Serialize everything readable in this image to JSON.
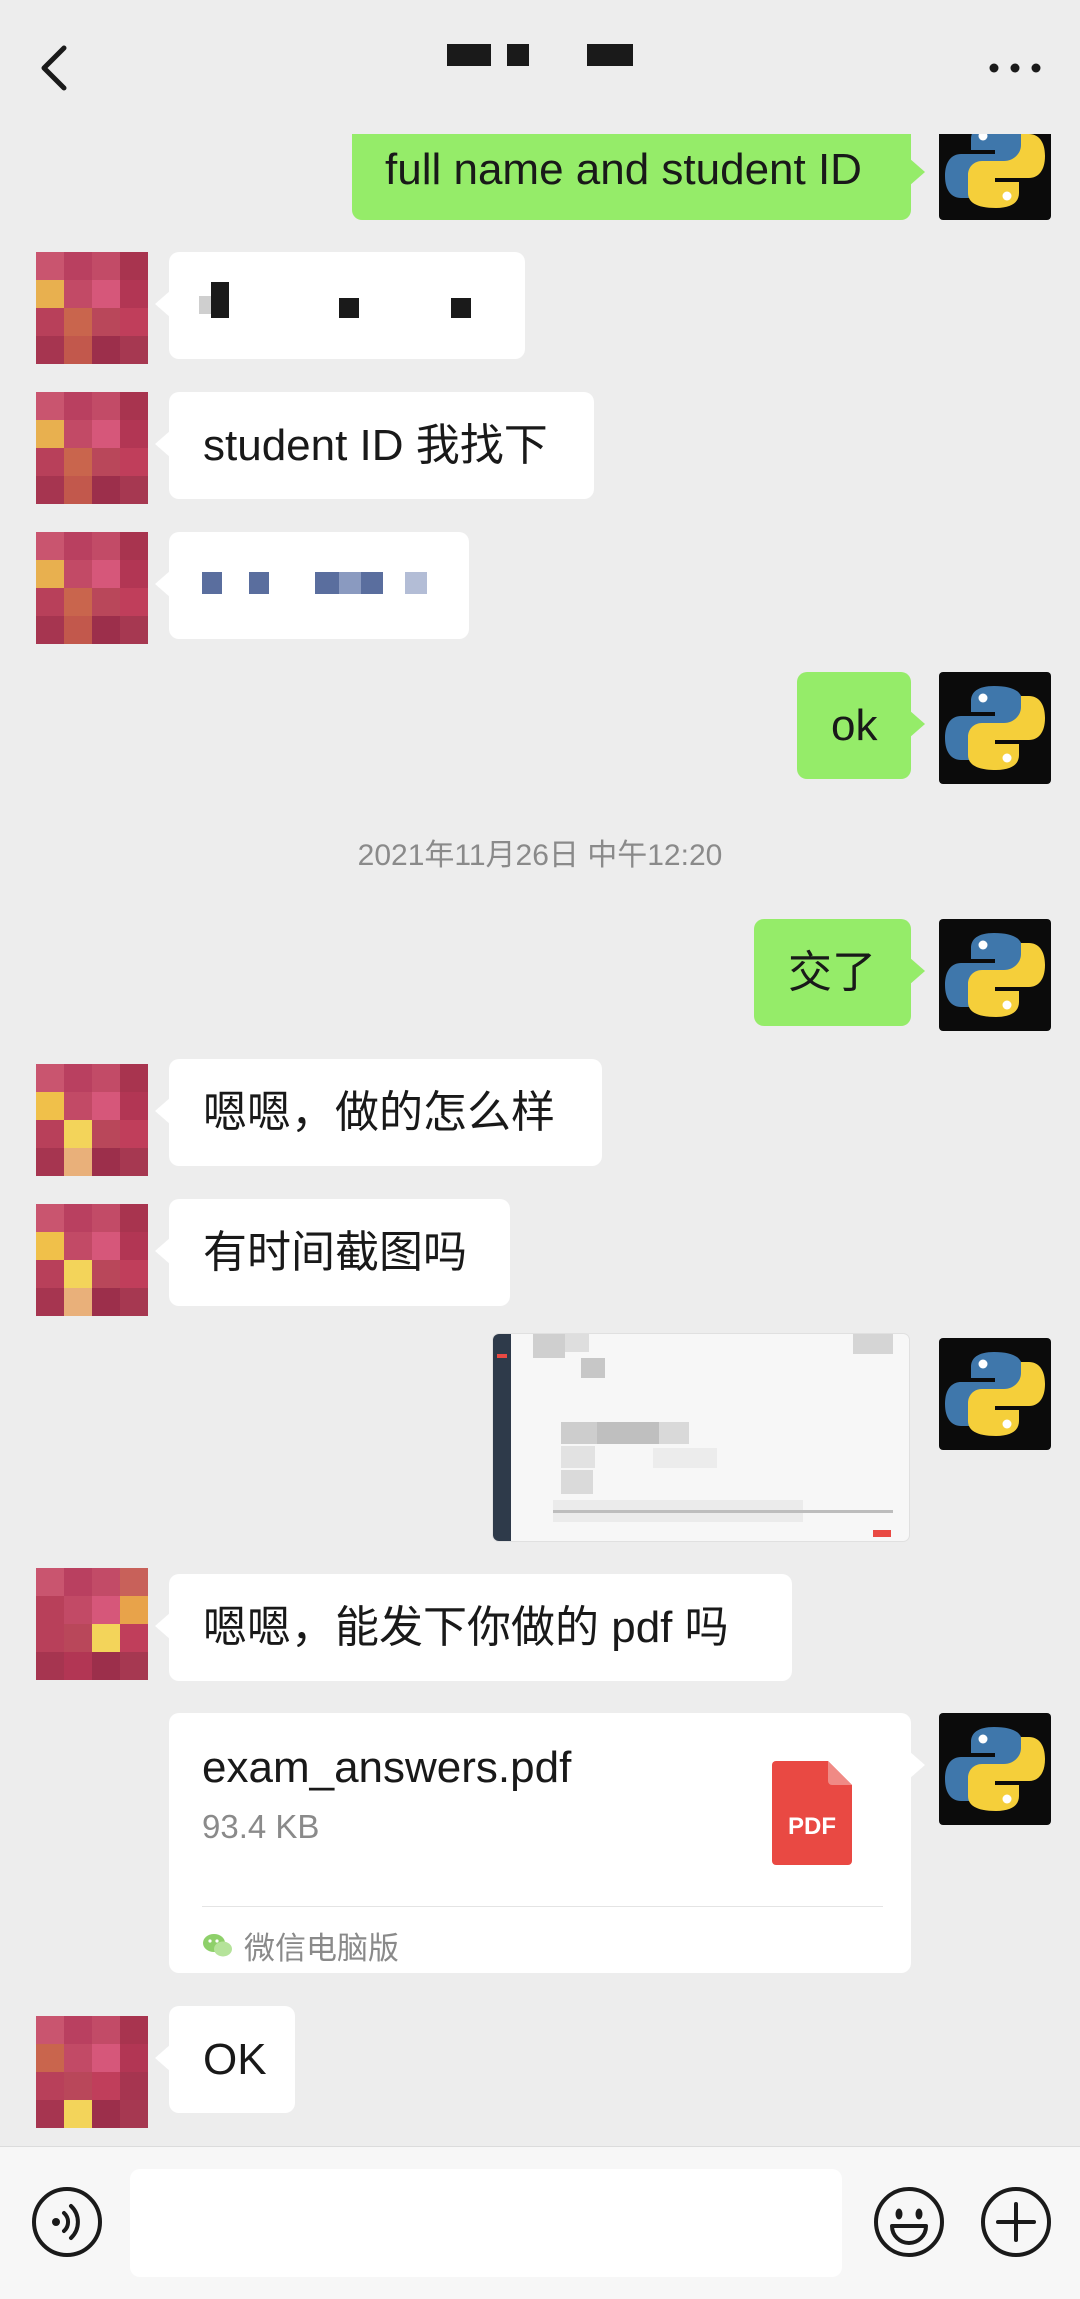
{
  "header": {
    "title": "",
    "back_icon": "chevron-left-icon",
    "more_icon": "more-dots-icon"
  },
  "messages": [
    {
      "side": "right",
      "text": "full name and student ID"
    },
    {
      "side": "left",
      "text": ""
    },
    {
      "side": "left",
      "text": "student ID 我找下"
    },
    {
      "side": "left",
      "text": ""
    },
    {
      "side": "right",
      "text": "ok"
    },
    {
      "side": "right",
      "text": "交了"
    },
    {
      "side": "left",
      "text": "嗯嗯，做的怎么样"
    },
    {
      "side": "left",
      "text": "有时间截图吗"
    },
    {
      "side": "left",
      "text": "嗯嗯，能发下你做的 pdf 吗"
    },
    {
      "side": "left",
      "text": "OK"
    }
  ],
  "timestamp": "2021年11月26日 中午12:20",
  "file": {
    "name": "exam_answers.pdf",
    "size": "93.4 KB",
    "type_label": "PDF",
    "source": "微信电脑版",
    "type_color": "#e94943"
  },
  "input_bar": {
    "voice_icon": "voice-icon",
    "emoji_icon": "emoji-icon",
    "plus_icon": "plus-icon",
    "placeholder": ""
  },
  "colors": {
    "background": "#ededed",
    "sent_bubble": "#95ec69",
    "received_bubble": "#ffffff"
  }
}
